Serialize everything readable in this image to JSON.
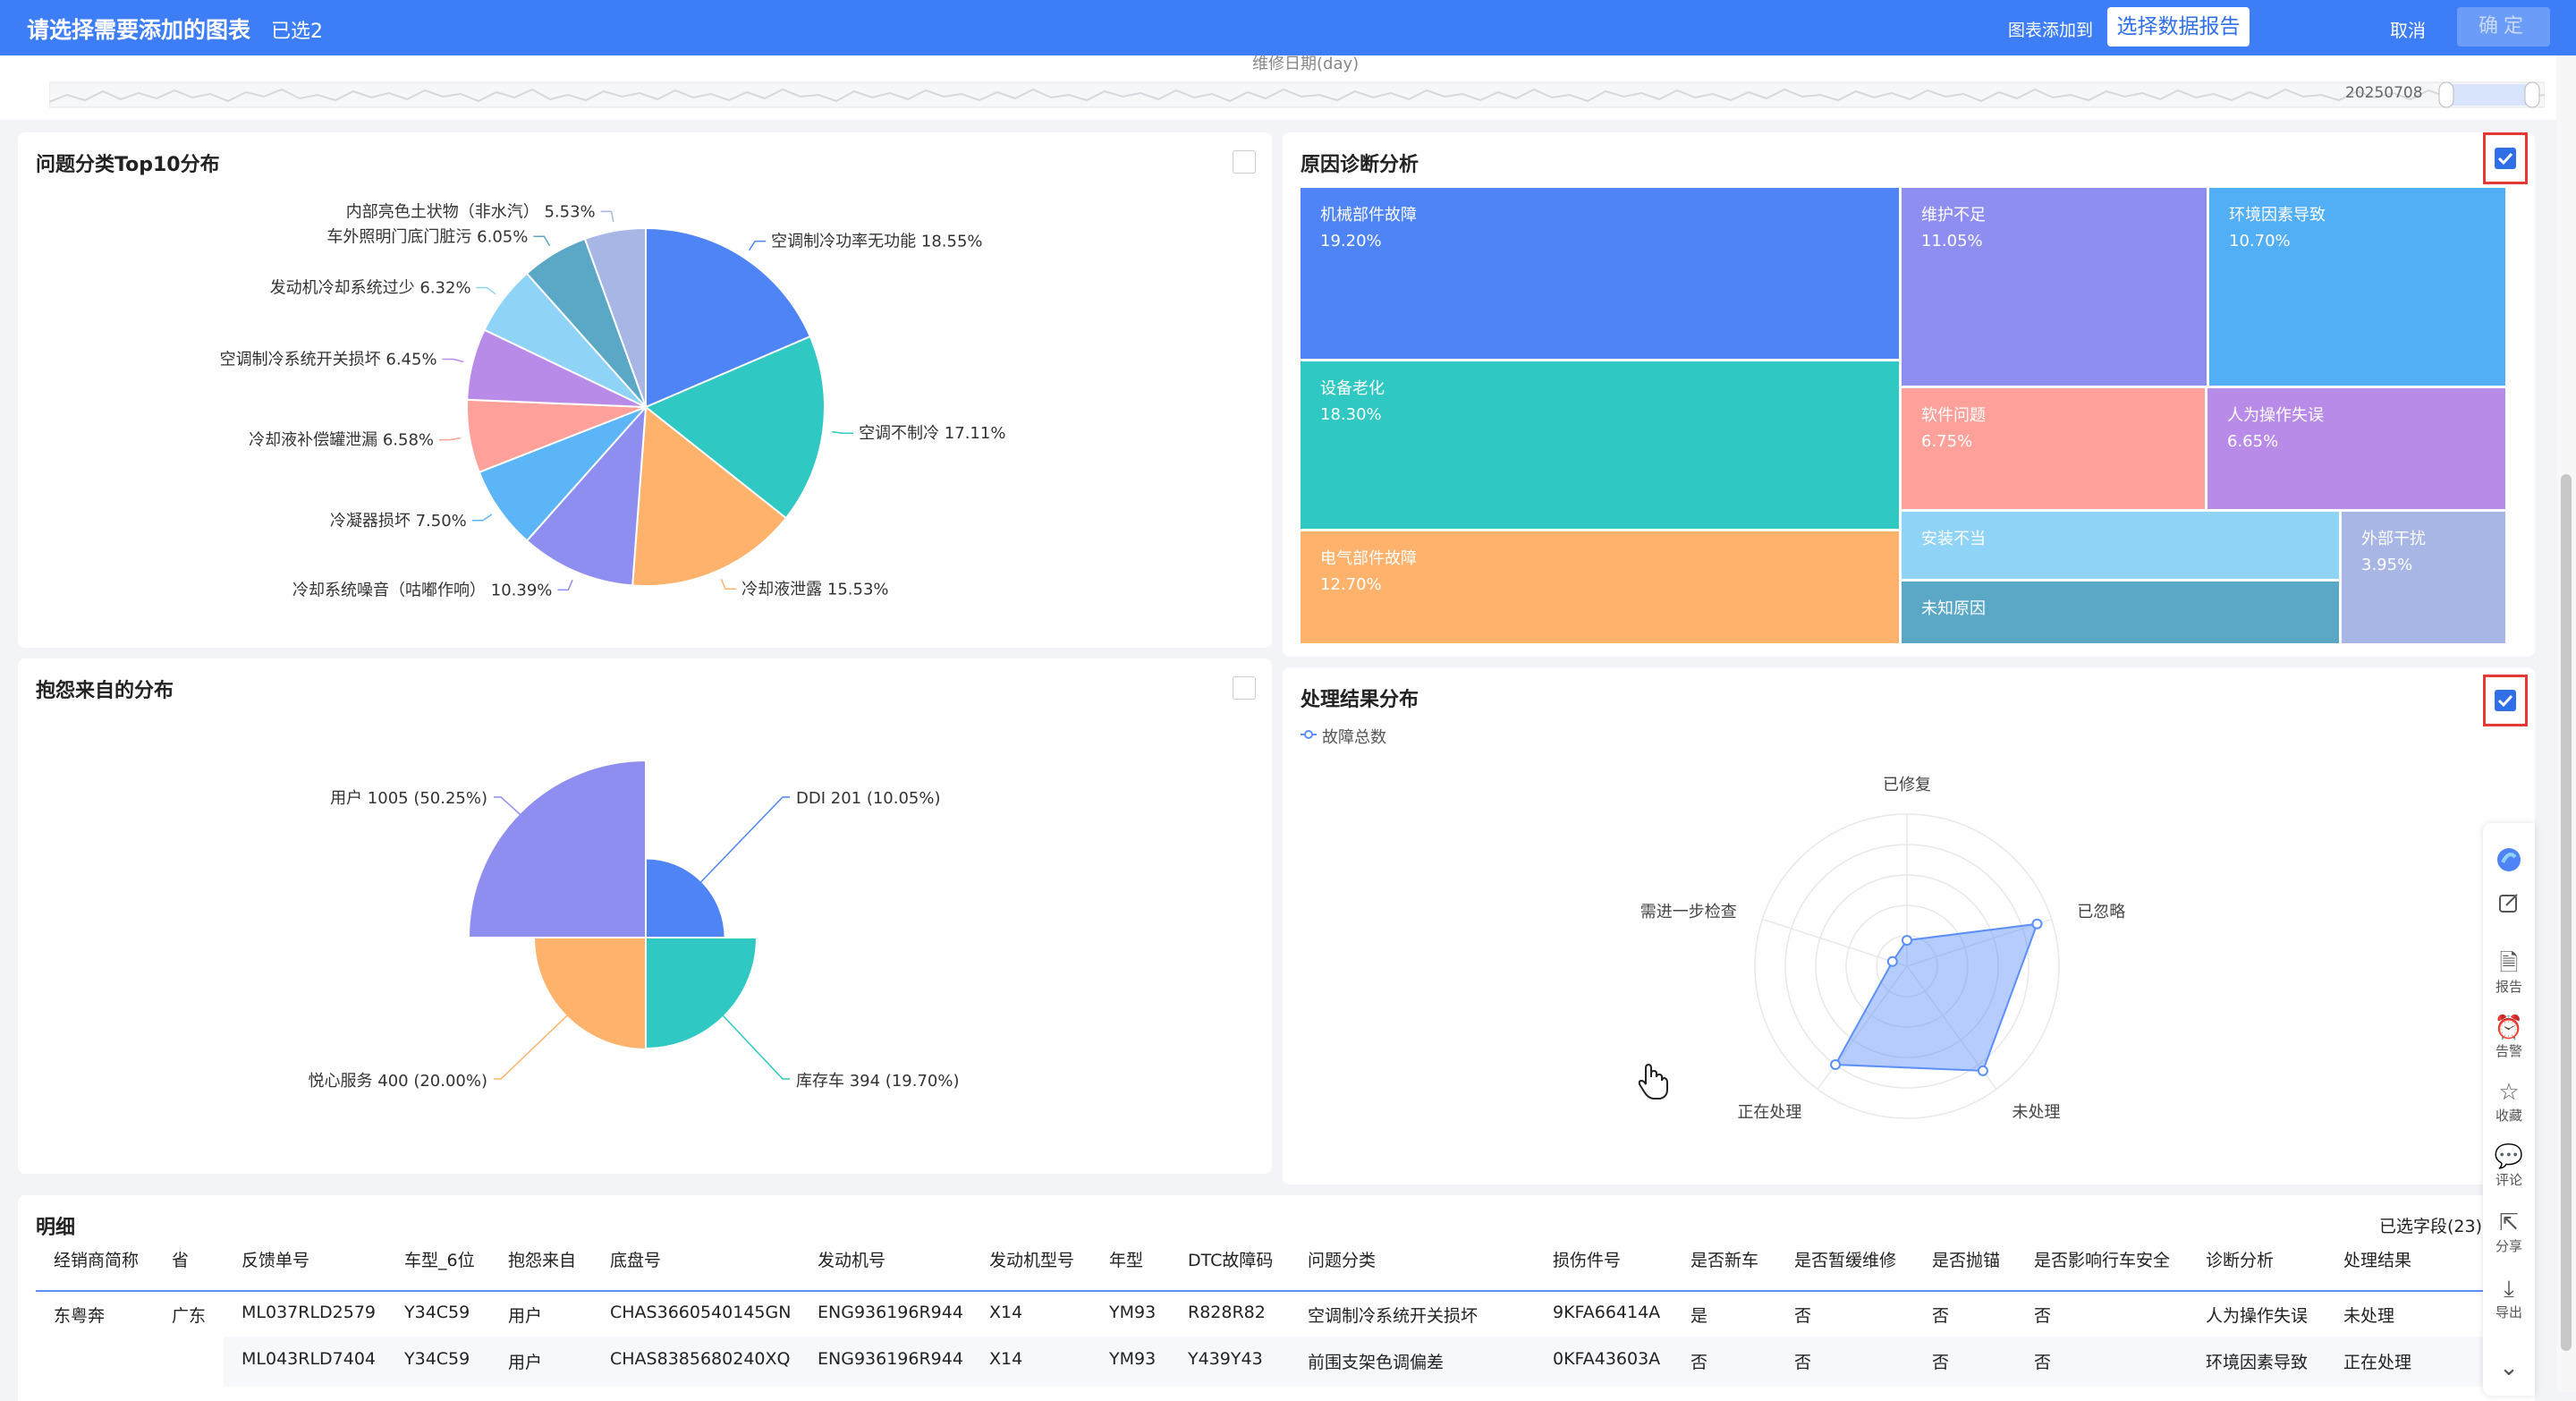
{
  "header": {
    "title": "请选择需要添加的图表",
    "selected_count": "已选2",
    "add_to_label": "图表添加到",
    "choose_report_button": "选择数据报告",
    "cancel_button": "取消",
    "confirm_button": "确定"
  },
  "timeline": {
    "axis_label": "维修日期(day)",
    "end_date": "20250708"
  },
  "colors": {
    "primary": "#3d7ef6",
    "checkbox_highlight": "#e53935"
  },
  "pie_card": {
    "title": "问题分类Top10分布",
    "checked": false,
    "chart_data": {
      "type": "pie",
      "slices": [
        {
          "label": "空调制冷功率无功能",
          "value": 18.55,
          "color": "#4e84f5"
        },
        {
          "label": "空调不制冷",
          "value": 17.11,
          "color": "#2fc8c2"
        },
        {
          "label": "冷却液泄露",
          "value": 15.53,
          "color": "#ffb26b"
        },
        {
          "label": "冷却系统噪音（咕嘟作响）",
          "value": 10.39,
          "color": "#8e8ef0"
        },
        {
          "label": "冷凝器损坏",
          "value": 7.5,
          "color": "#5cb5f7"
        },
        {
          "label": "冷却液补偿罐泄漏",
          "value": 6.58,
          "color": "#ffa19a"
        },
        {
          "label": "空调制冷系统开关损坏",
          "value": 6.45,
          "color": "#b98be8"
        },
        {
          "label": "发动机冷却系统过少",
          "value": 6.32,
          "color": "#8fd3f7"
        },
        {
          "label": "车外照明门底门脏污",
          "value": 6.05,
          "color": "#5aa8c6"
        },
        {
          "label": "内部亮色土状物（非水汽）",
          "value": 5.53,
          "color": "#a8b6e6"
        }
      ],
      "display_labels": [
        "空调制冷功率无功能 18.55%",
        "空调不制冷 17.11%",
        "冷却液泄露 15.53%",
        "冷却系统噪音（咕嘟作响） 10.39%",
        "冷凝器损坏 7.50%",
        "冷却液补偿罐泄漏 6.58%",
        "空调制冷系统开关损坏 6.45%",
        "发动机冷却系统过少 6.32%",
        "车外照明门底门脏污 6.05%",
        "内部亮色土状物（非水汽） 5.53%"
      ]
    }
  },
  "treemap_card": {
    "title": "原因诊断分析",
    "checked": true,
    "chart_data": {
      "type": "treemap",
      "items": [
        {
          "label": "机械部件故障",
          "value": "19.20%",
          "color": "#4e84f5"
        },
        {
          "label": "维护不足",
          "value": "11.05%",
          "color": "#8e8ef0"
        },
        {
          "label": "环境因素导致",
          "value": "10.70%",
          "color": "#52aef5"
        },
        {
          "label": "设备老化",
          "value": "18.30%",
          "color": "#2fc8c2"
        },
        {
          "label": "软件问题",
          "value": "6.75%",
          "color": "#ffa19a"
        },
        {
          "label": "人为操作失误",
          "value": "6.65%",
          "color": "#b98be8"
        },
        {
          "label": "电气部件故障",
          "value": "12.70%",
          "color": "#ffb26b"
        },
        {
          "label": "安装不当",
          "value": "",
          "color": "#8fd3f7"
        },
        {
          "label": "外部干扰",
          "value": "3.95%",
          "color": "#a8b6e6"
        },
        {
          "label": "未知原因",
          "value": "",
          "color": "#5aa8c6"
        }
      ]
    }
  },
  "rose_card": {
    "title": "抱怨来自的分布",
    "checked": false,
    "chart_data": {
      "type": "pie",
      "variant": "rose",
      "slices": [
        {
          "label": "DDI",
          "value": 201,
          "percent": "10.05%",
          "color": "#4e84f5"
        },
        {
          "label": "库存车",
          "value": 394,
          "percent": "19.70%",
          "color": "#2fc8c2"
        },
        {
          "label": "悦心服务",
          "value": 400,
          "percent": "20.00%",
          "color": "#ffb26b"
        },
        {
          "label": "用户",
          "value": 1005,
          "percent": "50.25%",
          "color": "#8e8ef0"
        }
      ],
      "display_labels": [
        "DDI 201 (10.05%)",
        "库存车 394 (19.70%)",
        "悦心服务 400 (20.00%)",
        "用户 1005 (50.25%)"
      ]
    }
  },
  "radar_card": {
    "title": "处理结果分布",
    "checked": true,
    "chart_data": {
      "type": "radar",
      "legend": "故障总数",
      "indicators": [
        "已修复",
        "已忽略",
        "未处理",
        "正在处理",
        "需进一步检查"
      ],
      "values": [
        0.17,
        0.9,
        0.85,
        0.8,
        0.1
      ]
    }
  },
  "detail": {
    "title": "明细",
    "selected_fields": "已选字段(23)",
    "columns": [
      "经销商简称",
      "省",
      "反馈单号",
      "车型_6位",
      "抱怨来自",
      "底盘号",
      "发动机号",
      "发动机型号",
      "年型",
      "DTC故障码",
      "问题分类",
      "损伤件号",
      "是否新车",
      "是否暂缓维修",
      "是否抛锚",
      "是否影响行车安全",
      "诊断分析",
      "处理结果"
    ],
    "rows": [
      [
        "东粤奔",
        "广东",
        "ML037RLD2579",
        "Y34C59",
        "用户",
        "CHAS3660540145GN",
        "ENG936196R944",
        "X14",
        "YM93",
        "R828R82",
        "空调制冷系统开关损坏",
        "9KFA66414A",
        "是",
        "否",
        "否",
        "否",
        "人为操作失误",
        "未处理"
      ],
      [
        "",
        "",
        "ML043RLD7404",
        "Y34C59",
        "用户",
        "CHAS8385680240XQ",
        "ENG936196R944",
        "X14",
        "YM93",
        "Y439Y43",
        "前围支架色调偏差",
        "0KFA43603A",
        "否",
        "否",
        "否",
        "否",
        "环境因素导致",
        "正在处理"
      ]
    ]
  },
  "sidebar": {
    "report": "报告",
    "alert": "告警",
    "favorite": "收藏",
    "comment": "评论",
    "share": "分享",
    "export": "导出"
  }
}
